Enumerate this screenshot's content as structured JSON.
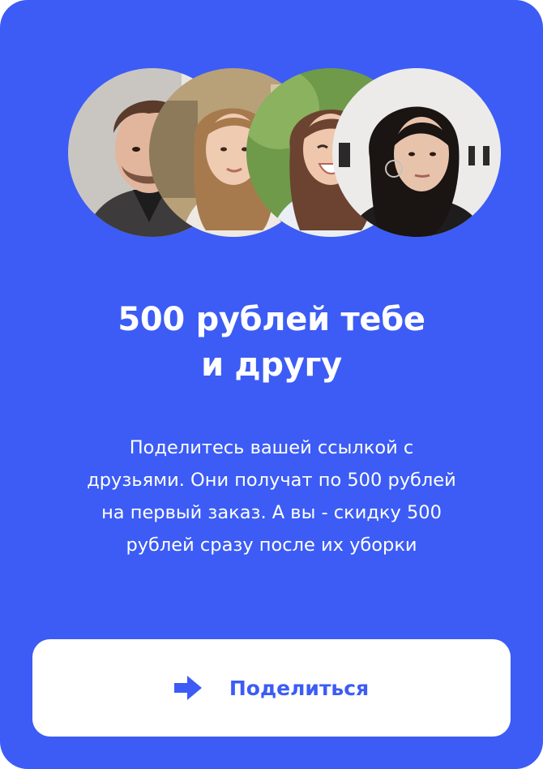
{
  "promo": {
    "headline_line1": "500 рублей тебе",
    "headline_line2": "и другу",
    "description_lines": [
      "Поделитесь вашей ссылкой с",
      "друзьями. Они получат по 500 рублей",
      "на первый заказ. А вы - скидку 500",
      "рублей сразу после их уборки"
    ]
  },
  "share_button": {
    "label": "Поделиться",
    "icon": "share-arrow-icon"
  },
  "avatars": [
    {
      "name": "avatar-man-beard"
    },
    {
      "name": "avatar-woman-blonde"
    },
    {
      "name": "avatar-woman-smiling"
    },
    {
      "name": "avatar-woman-dark-hair"
    }
  ],
  "colors": {
    "background": "#3c5cf5",
    "button_background": "#ffffff",
    "button_text": "#3c5cf5",
    "text": "#ffffff"
  }
}
